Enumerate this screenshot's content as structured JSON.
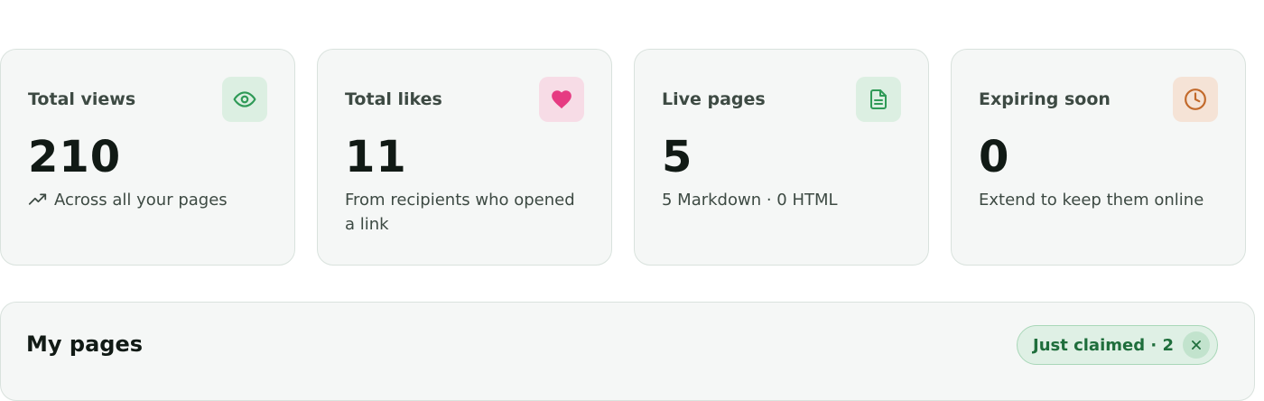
{
  "stats": [
    {
      "label": "Total views",
      "value": "210",
      "sub": "Across all your pages",
      "icon": "eye-icon",
      "icon_bg": "#dcefe2",
      "icon_color": "#2f9a57"
    },
    {
      "label": "Total likes",
      "value": "11",
      "sub": "From recipients who opened a link",
      "icon": "heart-icon",
      "icon_bg": "#f7dce6",
      "icon_color": "#e63b82"
    },
    {
      "label": "Live pages",
      "value": "5",
      "sub": "5 Markdown · 0 HTML",
      "icon": "document-icon",
      "icon_bg": "#dcefe2",
      "icon_color": "#2f9a57"
    },
    {
      "label": "Expiring soon",
      "value": "0",
      "sub": "Extend to keep them online",
      "icon": "clock-icon",
      "icon_bg": "#f5e3d6",
      "icon_color": "#c2692a"
    }
  ],
  "pages_panel": {
    "title": "My pages",
    "claimed_filter": "Just claimed · 2"
  }
}
